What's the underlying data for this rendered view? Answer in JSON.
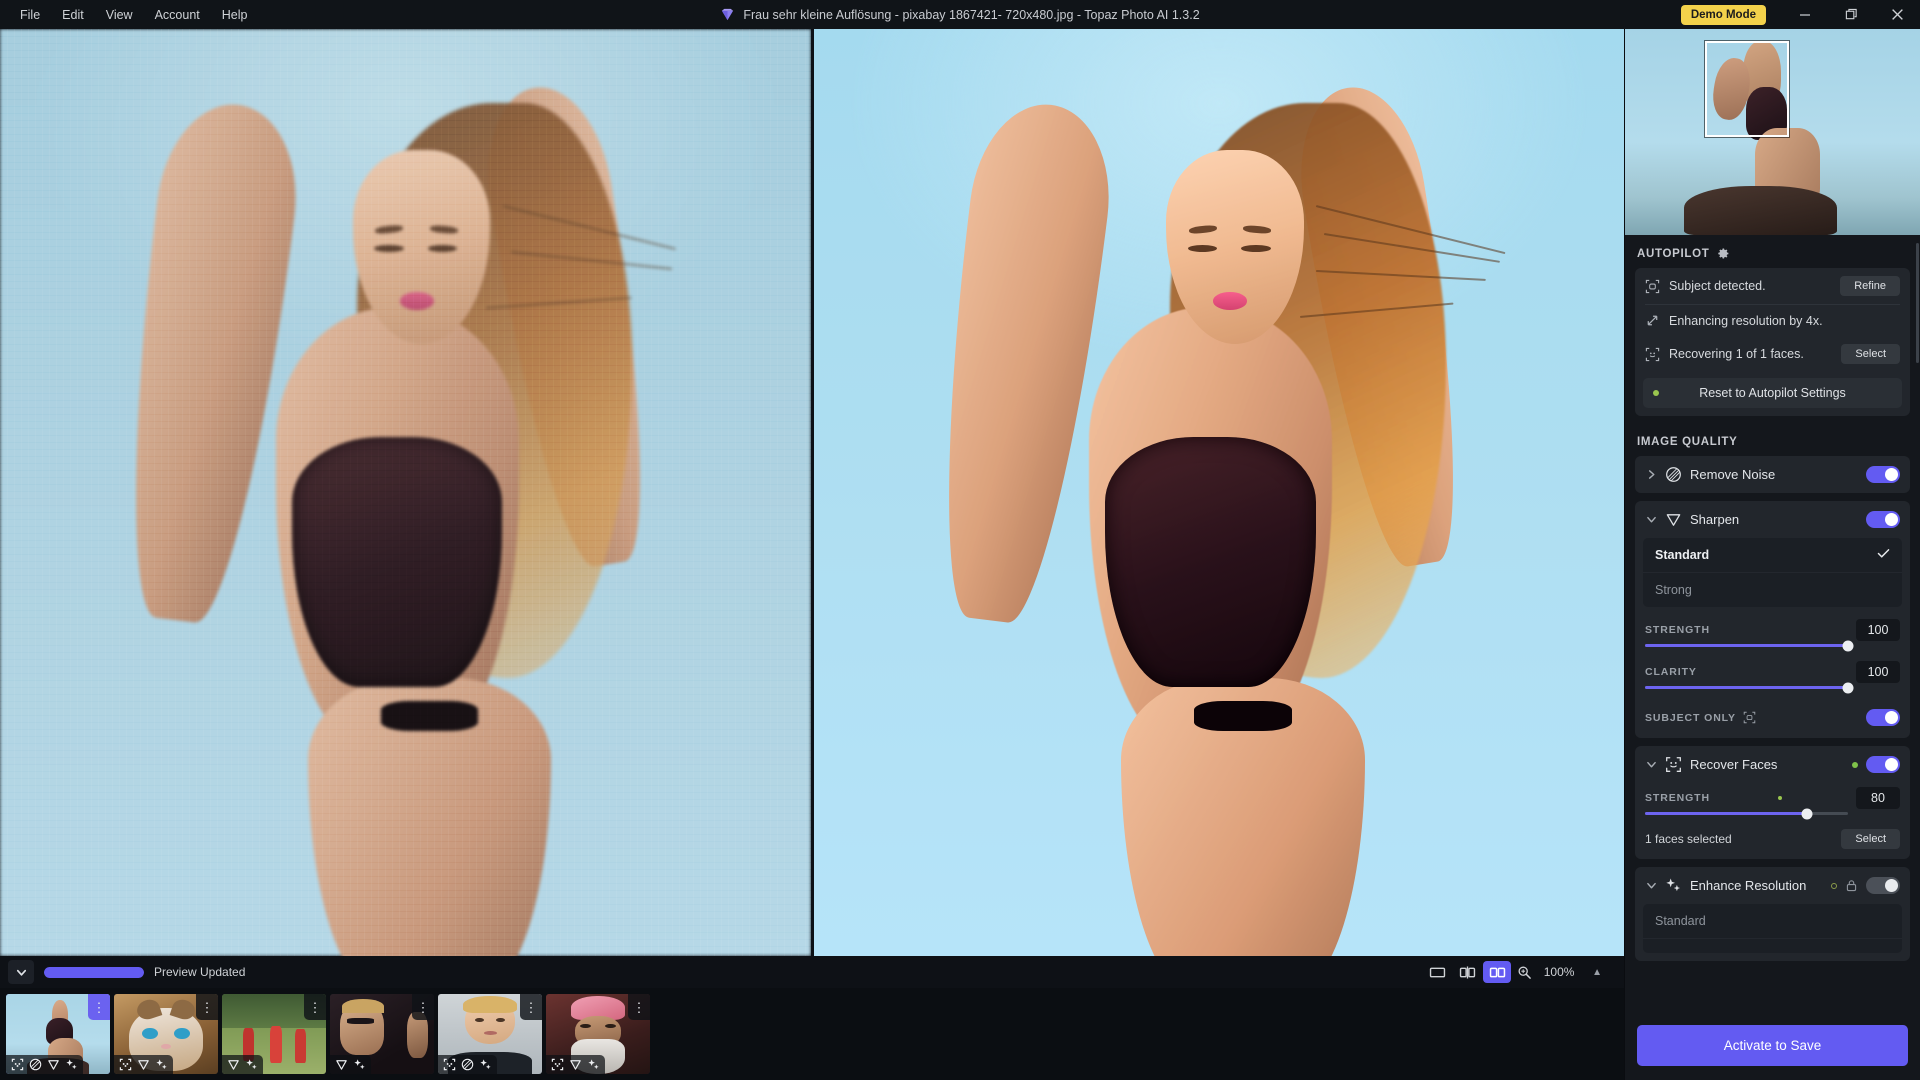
{
  "titlebar": {
    "menus": [
      {
        "label": "File"
      },
      {
        "label": "Edit"
      },
      {
        "label": "View"
      },
      {
        "label": "Account"
      },
      {
        "label": "Help"
      }
    ],
    "title": "Frau sehr kleine Auflösung - pixabay 1867421- 720x480.jpg - Topaz Photo AI 1.3.2",
    "logo_icon": "topaz-diamond-icon",
    "demo_badge": "Demo Mode",
    "window_buttons": {
      "minimize": "minimize-icon",
      "maximize": "maximize-icon",
      "close": "close-icon"
    }
  },
  "viewer": {
    "left_pane_label": "original-image-pane",
    "right_pane_label": "enhanced-image-pane"
  },
  "bottombar": {
    "collapse_icon": "chevron-down-icon",
    "progress_percent": 100,
    "status": "Preview Updated",
    "view_modes": [
      {
        "name": "single-view",
        "icon": "single-pane-icon",
        "active": false
      },
      {
        "name": "split-view",
        "icon": "split-pane-icon",
        "active": false
      },
      {
        "name": "side-by-side-view",
        "icon": "side-by-side-icon",
        "active": true
      }
    ],
    "zoom_icon": "zoom-magnifier-icon",
    "zoom_level": "100%",
    "expand_icon": "caret-up-icon"
  },
  "filmstrip": {
    "items": [
      {
        "name": "thumb-woman-beach",
        "selected": true,
        "badges": [
          "subject-icon",
          "remove-noise-icon",
          "sharpen-icon",
          "enhance-resolution-icon"
        ]
      },
      {
        "name": "thumb-cat",
        "selected": false,
        "badges": [
          "subject-icon",
          "sharpen-icon",
          "enhance-resolution-icon"
        ]
      },
      {
        "name": "thumb-football",
        "selected": false,
        "badges": [
          "sharpen-icon",
          "enhance-resolution-icon"
        ]
      },
      {
        "name": "thumb-dj-woman",
        "selected": false,
        "badges": [
          "sharpen-icon",
          "enhance-resolution-icon"
        ]
      },
      {
        "name": "thumb-boy",
        "selected": false,
        "badges": [
          "subject-icon",
          "remove-noise-icon",
          "enhance-resolution-icon"
        ]
      },
      {
        "name": "thumb-turban-man",
        "selected": false,
        "badges": [
          "subject-icon",
          "sharpen-icon",
          "enhance-resolution-icon"
        ]
      }
    ]
  },
  "navigator": {
    "name": "image-navigator",
    "viewport_rect": "viewport-indicator"
  },
  "panel": {
    "autopilot": {
      "title": "AUTOPILOT",
      "settings_icon": "gear-icon",
      "rows": [
        {
          "icon": "subject-detect-icon",
          "text": "Subject detected.",
          "button": "Refine"
        },
        {
          "icon": "resize-arrow-icon",
          "text": "Enhancing resolution by 4x.",
          "button": null
        },
        {
          "icon": "face-detect-icon",
          "text": "Recovering 1 of 1 faces.",
          "button": "Select"
        }
      ],
      "reset_button": "Reset to Autopilot Settings"
    },
    "image_quality": {
      "title": "IMAGE QUALITY",
      "filters": [
        {
          "name": "Remove Noise",
          "icon": "remove-noise-icon",
          "expanded": false,
          "enabled": true
        },
        {
          "name": "Sharpen",
          "icon": "sharpen-icon",
          "expanded": true,
          "enabled": true,
          "options": [
            {
              "label": "Standard",
              "selected": true
            },
            {
              "label": "Strong",
              "selected": false
            }
          ],
          "sliders": [
            {
              "label": "STRENGTH",
              "value": 100,
              "percent": 100
            },
            {
              "label": "CLARITY",
              "value": 100,
              "percent": 100
            }
          ],
          "subject_only": {
            "label": "SUBJECT ONLY",
            "icon": "subject-detect-icon",
            "enabled": true
          }
        },
        {
          "name": "Recover Faces",
          "icon": "face-detect-icon",
          "expanded": true,
          "enabled": true,
          "changed_dot": true,
          "sliders": [
            {
              "label": "STRENGTH",
              "value": 80,
              "percent": 80
            }
          ],
          "faces_text": "1 faces selected",
          "select_button": "Select"
        },
        {
          "name": "Enhance Resolution",
          "icon": "enhance-resolution-icon",
          "expanded": true,
          "enabled": false,
          "locked": true,
          "lock_icon": "lock-icon",
          "options": [
            {
              "label": "Standard",
              "selected": false
            }
          ]
        }
      ]
    },
    "activate_button": "Activate to Save"
  }
}
